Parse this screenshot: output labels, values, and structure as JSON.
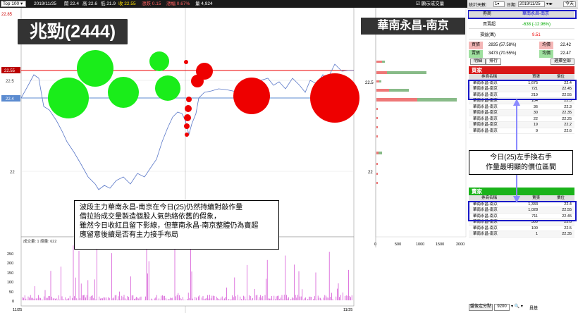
{
  "toolbar": {
    "top_select": "Top 100",
    "date": "2019/11/25",
    "open": "開 22.4",
    "high": "高 22.6",
    "low": "低 21.9",
    "close": "收 22.55",
    "change": "漲跌 0.15",
    "pct": "漲幅 0.67%",
    "volume": "量 4,924",
    "show_volume": "顯示成交量"
  },
  "right_toolbar": {
    "days_label": "統計天數:",
    "days": "1",
    "date_label": "日期:",
    "date": "2019/11/25",
    "today": "今天"
  },
  "chart": {
    "title": "兆勁(2444)",
    "yticks": [
      "22.85",
      "22.5",
      "22"
    ],
    "price_tags": [
      "22.55",
      "22.4"
    ],
    "vol_label": "成交量: 1  總量: 622",
    "vol_ticks": [
      "250",
      "200",
      "150",
      "100",
      "50",
      "0"
    ],
    "x_start": "11/25",
    "x_end": "11/25",
    "annotation": [
      "波段主力華南永昌-南京在今日(25)仍然持續對敲作量",
      "借拉抬成交量製造個股人氣熱絡依舊的假象，",
      "雖然今日收紅且留下影線，但華南永昌-南京整體仍為賣超",
      "應留意後續是否有主力接手布局"
    ]
  },
  "broker_chart": {
    "title": "華南永昌-南京",
    "yticks": [
      "22.5",
      "22"
    ],
    "xticks": [
      "0",
      "500",
      "1000",
      "1500",
      "2000"
    ]
  },
  "panel": {
    "broker_label": "券商",
    "broker_value": "華南永昌-南京",
    "net_label": "買賣超",
    "net_value": "-638 (-12.96%)",
    "pl_label": "損益(萬)",
    "pl_value": "9.51",
    "buy_label": "買張",
    "buy_value": "2835 (57.58%)",
    "buy_avg_label": "均價",
    "buy_avg": "22.42",
    "sell_label": "賣張",
    "sell_value": "3473 (70.55%)",
    "sell_avg_label": "均價",
    "sell_avg": "22.47",
    "tab1": "明細",
    "tab2": "排行",
    "select_all": "選擇全部",
    "buyers_title": "買家",
    "sellers_title": "賣家",
    "col_broker": "券商名稱",
    "col_qty": "買張",
    "col_price": "價位",
    "sell_col_qty": "賣張",
    "buyers": [
      {
        "name": "華南永昌-南京",
        "qty": "1,675",
        "price": "22.4"
      },
      {
        "name": "華南永昌-南京",
        "qty": "721",
        "price": "22.45"
      },
      {
        "name": "華南永昌-南京",
        "qty": "219",
        "price": "22.55"
      },
      {
        "name": "華南永昌-南京",
        "qty": "104",
        "price": "22.5"
      },
      {
        "name": "華南永昌-南京",
        "qty": "36",
        "price": "22.3"
      },
      {
        "name": "華南永昌-南京",
        "qty": "30",
        "price": "22.35"
      },
      {
        "name": "華南永昌-南京",
        "qty": "22",
        "price": "22.25"
      },
      {
        "name": "華南永昌-南京",
        "qty": "19",
        "price": "22.2"
      },
      {
        "name": "華南永昌-南京",
        "qty": "9",
        "price": "22.6"
      }
    ],
    "sellers": [
      {
        "name": "華南永昌-南京",
        "qty": "1,333",
        "price": "22.4"
      },
      {
        "name": "華南永昌-南京",
        "qty": "1,028",
        "price": "22.55"
      },
      {
        "name": "華南永昌-南京",
        "qty": "711",
        "price": "22.45"
      },
      {
        "name": "華南永昌-南京",
        "qty": "300",
        "price": "22.6"
      },
      {
        "name": "華南永昌-南京",
        "qty": "100",
        "price": "22.5"
      },
      {
        "name": "華南永昌-南京",
        "qty": "1",
        "price": "22.35"
      }
    ],
    "callout": [
      "今日(25)左手換右手",
      "作量最明顯的價位區間"
    ],
    "footer_btn": "盤後定分點",
    "footer_num": "9200",
    "footer_end": "員基"
  }
}
